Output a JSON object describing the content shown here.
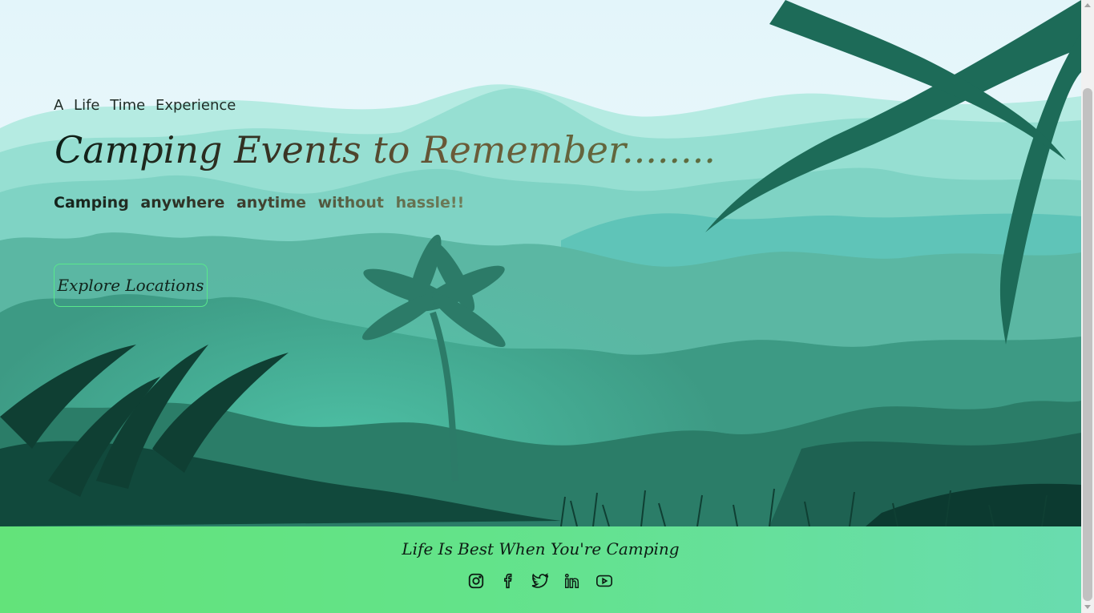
{
  "hero": {
    "tagline": "A Life Time Experience",
    "headline": "Camping Events to Remember........",
    "subline": "Camping anywhere anytime without hassle!!",
    "explore_button": "Explore Locations"
  },
  "footer": {
    "text": "Life Is Best When You're Camping",
    "socials": [
      "instagram-icon",
      "facebook-icon",
      "twitter-icon",
      "linkedin-icon",
      "youtube-icon"
    ]
  },
  "colors": {
    "sky": "#e6f6fb",
    "mountain_far": "#a9e6da",
    "mountain_mid": "#72cfbd",
    "forest": "#2f8f78",
    "forest_dark": "#0f4a3c",
    "button_border": "#59e88c",
    "footer_start": "#63e37a",
    "footer_end": "#69dcaf"
  }
}
